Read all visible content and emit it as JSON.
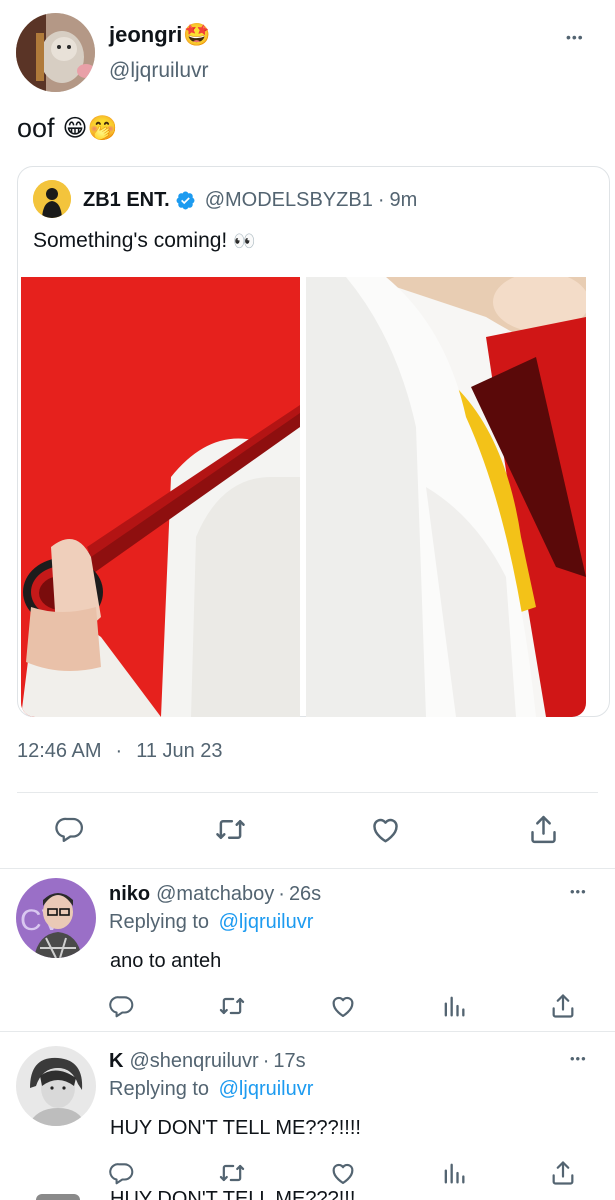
{
  "main_tweet": {
    "author_name": "jeongri",
    "author_emoji": "🤩",
    "handle": "@ljqruiluvr",
    "text": "oof",
    "text_emojis": "😁🤭",
    "timestamp_time": "12:46 AM",
    "timestamp_sep": "·",
    "timestamp_date": "11 Jun 23",
    "more_label": "•••"
  },
  "quoted_tweet": {
    "author_name": "ZB1 ENT.",
    "handle": "@MODELSBYZB1",
    "sep": "·",
    "time": "9m",
    "text": "Something's coming!",
    "text_emoji": "👀"
  },
  "replies": [
    {
      "name": "niko",
      "handle": "@matchaboy",
      "sep": "·",
      "time": "26s",
      "replying_prefix": "Replying to",
      "replying_to": "@ljqruiluvr",
      "text": "ano to anteh",
      "more_label": "•••"
    },
    {
      "name": "K",
      "handle": "@shenqruiluvr",
      "sep": "·",
      "time": "17s",
      "replying_prefix": "Replying to",
      "replying_to": "@ljqruiluvr",
      "text": "HUY DON'T TELL ME???!!!!",
      "more_label": "•••"
    }
  ],
  "cut_off_text": "HUY DON'T TELL ME???!!!",
  "colors": {
    "accent": "#1d9bf0",
    "verified": "#1d9bf0",
    "icon_gray": "#536471",
    "divider": "#e6e9eb"
  },
  "icons": {
    "reply": "reply-icon",
    "retweet": "retweet-icon",
    "like": "heart-icon",
    "share": "share-icon",
    "analytics": "analytics-icon",
    "verified": "verified-badge-icon",
    "more": "more-icon"
  }
}
